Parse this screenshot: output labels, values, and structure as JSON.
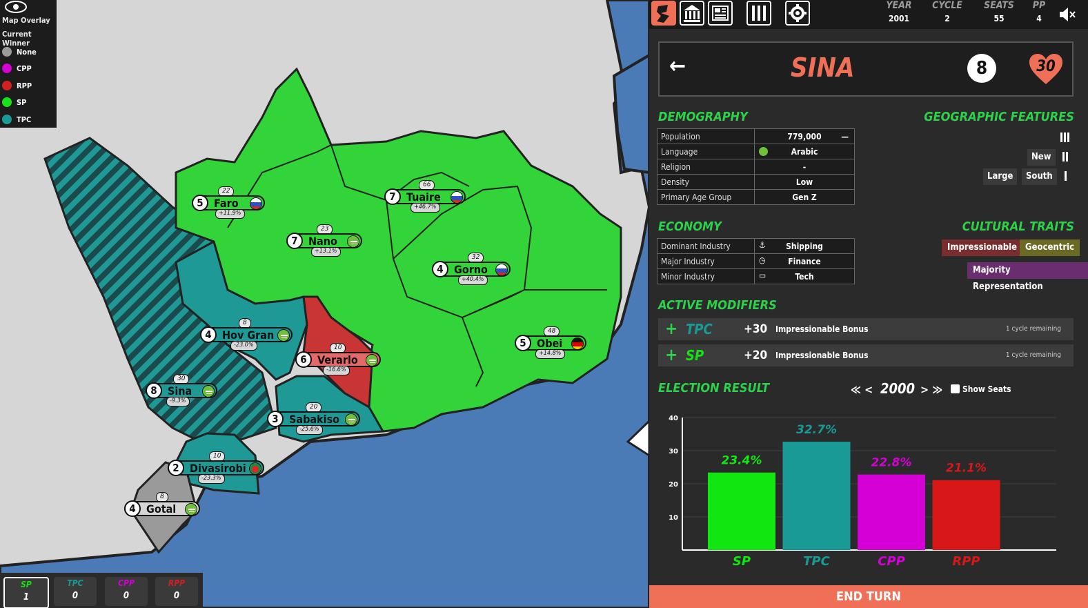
{
  "map_overlay": {
    "title": "Map Overlay",
    "mode": "Current Winner",
    "legend": [
      {
        "label": "None",
        "color": "#9a9a9a"
      },
      {
        "label": "CPP",
        "color": "#d400d4"
      },
      {
        "label": "RPP",
        "color": "#d31f1f"
      },
      {
        "label": "SP",
        "color": "#17e117"
      },
      {
        "label": "TPC",
        "color": "#1a9a96"
      }
    ]
  },
  "regions": [
    {
      "name": "Faro",
      "rank": "5",
      "seats": "22",
      "change": "+11.9%",
      "color": "#33d33a",
      "flag": "russia"
    },
    {
      "name": "Tuaire",
      "rank": "7",
      "seats": "66",
      "change": "+46.7%",
      "color": "#33d33a",
      "flag": "russia"
    },
    {
      "name": "Nano",
      "rank": "7",
      "seats": "23",
      "change": "+13.1%",
      "color": "#33d33a",
      "flag": "arabic"
    },
    {
      "name": "Gorno",
      "rank": "4",
      "seats": "32",
      "change": "+40.4%",
      "color": "#33d33a",
      "flag": "russia"
    },
    {
      "name": "Hov Gran",
      "rank": "4",
      "seats": "8",
      "change": "-23.0%",
      "color": "#1f9996",
      "flag": "arabic"
    },
    {
      "name": "Verarlo",
      "rank": "6",
      "seats": "10",
      "change": "-16.6%",
      "color": "#e46a6a",
      "flag": "arabic"
    },
    {
      "name": "Obei",
      "rank": "5",
      "seats": "48",
      "change": "+14.8%",
      "color": "#33d33a",
      "flag": "germany"
    },
    {
      "name": "Sina",
      "rank": "8",
      "seats": "30",
      "change": "-9.3%",
      "color": "#1f9996",
      "flag": "arabic"
    },
    {
      "name": "Sabakiso",
      "rank": "3",
      "seats": "20",
      "change": "-25.6%",
      "color": "#1f9996",
      "flag": "arabic"
    },
    {
      "name": "Divasirobi",
      "rank": "2",
      "seats": "10",
      "change": "-23.3%",
      "color": "#1f9996",
      "flag": "bangladesh"
    },
    {
      "name": "Gotal",
      "rank": "4",
      "seats": "8",
      "change": "",
      "color": "#d6d6d6",
      "flag": "arabic"
    }
  ],
  "bottom_scores": [
    {
      "party": "SP",
      "value": "1",
      "color": "#17e117"
    },
    {
      "party": "TPC",
      "value": "0",
      "color": "#1a9a96"
    },
    {
      "party": "CPP",
      "value": "0",
      "color": "#d400d4"
    },
    {
      "party": "RPP",
      "value": "0",
      "color": "#d31f1f"
    }
  ],
  "topbar": {
    "stats": [
      {
        "label": "YEAR",
        "value": "2001"
      },
      {
        "label": "CYCLE",
        "value": "2"
      },
      {
        "label": "SEATS",
        "value": "55"
      },
      {
        "label": "PP",
        "value": "4"
      }
    ]
  },
  "header": {
    "back": "←",
    "region": "SINA",
    "rank": "8",
    "seats": "30"
  },
  "demography": {
    "title": "DEMOGRAPHY",
    "rows": [
      {
        "key": "Population",
        "value": "779,000",
        "extra": "—"
      },
      {
        "key": "Language",
        "value": "Arabic"
      },
      {
        "key": "Religion",
        "value": "-"
      },
      {
        "key": "Density",
        "value": "Low"
      },
      {
        "key": "Primary Age Group",
        "value": "Gen Z"
      }
    ]
  },
  "geographic": {
    "title": "GEOGRAPHIC FEATURES",
    "tags": [
      "New",
      "Large",
      "South"
    ]
  },
  "economy": {
    "title": "ECONOMY",
    "rows": [
      {
        "key": "Dominant Industry",
        "value": "Shipping",
        "icon": "ship-icon"
      },
      {
        "key": "Major Industry",
        "value": "Finance",
        "icon": "clock-icon"
      },
      {
        "key": "Minor Industry",
        "value": "Tech",
        "icon": "laptop-icon"
      }
    ]
  },
  "cultural": {
    "title": "CULTURAL TRAITS",
    "traits": [
      {
        "label": "Impressionable",
        "bg": "#7a2d2d"
      },
      {
        "label": "Geocentric",
        "bg": "#6a6a24"
      },
      {
        "label": "Majority Representation",
        "bg": "#6a2d6e"
      }
    ]
  },
  "modifiers": {
    "title": "ACTIVE MODIFIERS",
    "items": [
      {
        "party": "TPC",
        "color": "#1a9a96",
        "amount": "+30",
        "desc": "Impressionable Bonus",
        "remaining": "1 cycle remaining"
      },
      {
        "party": "SP",
        "color": "#17e117",
        "amount": "+20",
        "desc": "Impressionable Bonus",
        "remaining": "1 cycle remaining"
      }
    ]
  },
  "election": {
    "title": "ELECTION RESULT",
    "prev": "≪ <",
    "year": "2000",
    "next": "> ≫",
    "show_seats": "Show Seats"
  },
  "chart_data": {
    "type": "bar",
    "categories": [
      "SP",
      "TPC",
      "CPP",
      "RPP"
    ],
    "values": [
      23.4,
      32.7,
      22.8,
      21.1
    ],
    "labels": [
      "23.4%",
      "32.7%",
      "22.8%",
      "21.1%"
    ],
    "colors": [
      "#11e611",
      "#1a9a96",
      "#d500d5",
      "#d81818"
    ],
    "ylim": [
      0,
      40
    ],
    "yticks": [
      10,
      20,
      30,
      40
    ],
    "grid": true
  },
  "end_turn": "END TURN"
}
